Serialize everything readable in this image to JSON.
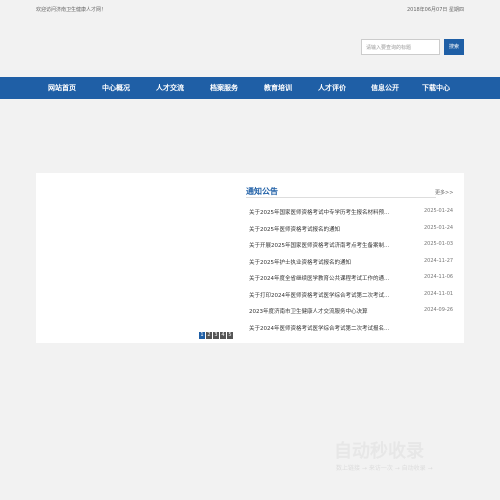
{
  "header": {
    "welcome": "欢迎访问济南卫生健康人才网！",
    "date": "2018年06月07日 星期四"
  },
  "search": {
    "placeholder": "请输入要查询的标题",
    "button_label": "搜索"
  },
  "nav": {
    "items": [
      "网站首页",
      "中心概况",
      "人才交流",
      "档案服务",
      "教育培训",
      "人才评价",
      "信息公开",
      "下载中心"
    ]
  },
  "notices": {
    "title": "通知公告",
    "more": "更多>>",
    "items": [
      {
        "title": "关于2025年国家医师资格考试中专学历考生报名材料预...",
        "date": "2025-01-24"
      },
      {
        "title": "关于2025年医师资格考试报名的通知",
        "date": "2025-01-24"
      },
      {
        "title": "关于开展2025年国家医师资格考试济南考点考生备案制...",
        "date": "2025-01-03"
      },
      {
        "title": "关于2025年护士执业资格考试报名的通知",
        "date": "2024-11-27"
      },
      {
        "title": "关于2024年度全省继续医学教育公共课程考试工作的通...",
        "date": "2024-11-06"
      },
      {
        "title": "关于打印2024年医师资格考试医学综合考试第二次考试...",
        "date": "2024-11-01"
      },
      {
        "title": "2023年度济南市卫生健康人才交流服务中心决算",
        "date": "2024-09-26"
      },
      {
        "title": "关于2024年医师资格考试医学综合考试第二次考试报名...",
        "date": ""
      }
    ]
  },
  "slideshow": {
    "pages": [
      "1",
      "2",
      "3",
      "4",
      "5"
    ]
  },
  "watermark": {
    "logo": "自动秒收录",
    "tagline": "数上链接 → 来访一次 → 自动收录 →"
  },
  "colors": {
    "brand_blue": "#1f5fa6",
    "page_bg": "#f2f2f2"
  }
}
